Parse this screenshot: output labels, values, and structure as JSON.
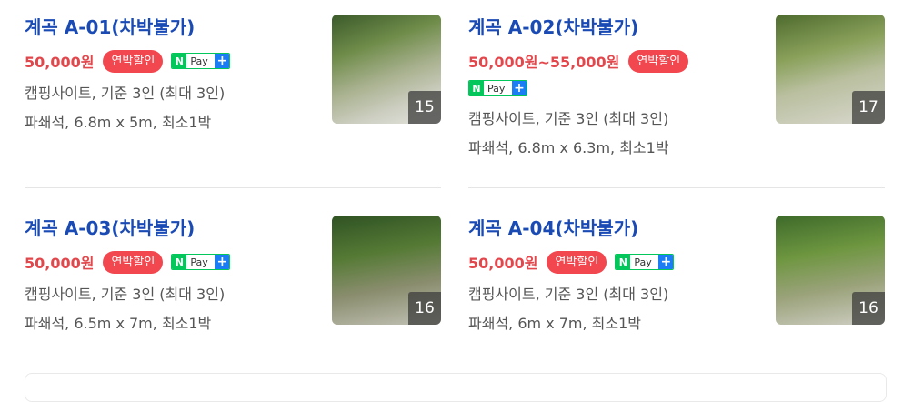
{
  "listings": [
    {
      "title": "계곡 A-01(차박불가)",
      "price": "50,000원",
      "badge": "연박할인",
      "pay": {
        "n": "N",
        "label": "Pay",
        "plus": "+"
      },
      "capacity": "캠핑사이트, 기준 3인 (최대 3인)",
      "details": "파쇄석, 6.8m x 5m, 최소1박",
      "photo_count": "15"
    },
    {
      "title": "계곡 A-02(차박불가)",
      "price": "50,000원~55,000원",
      "badge": "연박할인",
      "pay": {
        "n": "N",
        "label": "Pay",
        "plus": "+"
      },
      "capacity": "캠핑사이트, 기준 3인 (최대 3인)",
      "details": "파쇄석, 6.8m x 6.3m, 최소1박",
      "photo_count": "17"
    },
    {
      "title": "계곡 A-03(차박불가)",
      "price": "50,000원",
      "badge": "연박할인",
      "pay": {
        "n": "N",
        "label": "Pay",
        "plus": "+"
      },
      "capacity": "캠핑사이트, 기준 3인 (최대 3인)",
      "details": "파쇄석, 6.5m x 7m, 최소1박",
      "photo_count": "16"
    },
    {
      "title": "계곡 A-04(차박불가)",
      "price": "50,000원",
      "badge": "연박할인",
      "pay": {
        "n": "N",
        "label": "Pay",
        "plus": "+"
      },
      "capacity": "캠핑사이트, 기준 3인 (최대 3인)",
      "details": "파쇄석, 6m x 7m, 최소1박",
      "photo_count": "16"
    }
  ],
  "colors": {
    "title": "#1a4bb5",
    "price": "#e2474c",
    "badge_bg": "#f2474f",
    "npay_green": "#03c75a",
    "npay_blue": "#1a7df5"
  }
}
